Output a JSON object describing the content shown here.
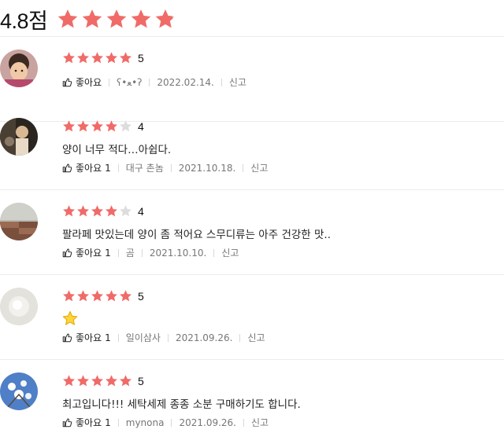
{
  "summary": {
    "score_text": "4.8점",
    "star_rating": 4.8
  },
  "colors": {
    "star_filled": "#f06b68",
    "star_empty": "#dddddd",
    "divider": "#ececec"
  },
  "reviews": [
    {
      "rating": 5,
      "score_label": "5",
      "text": "",
      "like_label": "좋아요",
      "like_count": "",
      "author": "ʕ•ﻌ•ʔ",
      "date": "2022.02.14.",
      "report_label": "신고"
    },
    {
      "rating": 4,
      "score_label": "4",
      "text": "양이 너무 적다…아쉽다.",
      "like_label": "좋아요",
      "like_count": "1",
      "author": "대구 촌놈",
      "date": "2021.10.18.",
      "report_label": "신고"
    },
    {
      "rating": 4,
      "score_label": "4",
      "text": "팔라페 맛있는데 양이 좀 적어요 스무디류는 아주 건강한 맛..",
      "like_label": "좋아요",
      "like_count": "1",
      "author": "곰",
      "date": "2021.10.10.",
      "report_label": "신고"
    },
    {
      "rating": 5,
      "score_label": "5",
      "text": "",
      "text_icon": "star-emoji-icon",
      "like_label": "좋아요",
      "like_count": "1",
      "author": "일이삼사",
      "date": "2021.09.26.",
      "report_label": "신고"
    },
    {
      "rating": 5,
      "score_label": "5",
      "text": "최고입니다!!! 세탁세제 종종 소분 구매하기도 합니다.",
      "like_label": "좋아요",
      "like_count": "1",
      "author": "mynona",
      "date": "2021.09.26.",
      "report_label": "신고"
    }
  ]
}
